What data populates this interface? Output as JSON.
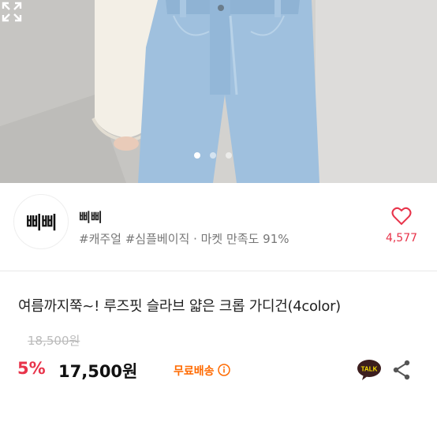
{
  "gallery": {
    "expand_icon": "expand-icon",
    "current_slide": 1,
    "total_slides": 3
  },
  "seller": {
    "logo_text": "삐삐",
    "name": "삐삐",
    "meta": "#캐주얼 #심플베이직 · 마켓 만족도 91%",
    "like_icon": "heart-outline-icon",
    "like_count": "4,577"
  },
  "product": {
    "title": "여름까지쭉~! 루즈핏 슬라브 얇은 크롭 가디건(4color)",
    "original_price": "18,500원",
    "discount": "5%",
    "price": "17,500원",
    "shipping": "무료배송",
    "shipping_info_icon": "info-icon",
    "talk_icon": "kakaotalk-icon",
    "talk_label": "TALK",
    "share_icon": "share-icon"
  },
  "colors": {
    "accent": "#e8334a",
    "shipping": "#ff6a00",
    "kakao": "#3c1e1e"
  }
}
